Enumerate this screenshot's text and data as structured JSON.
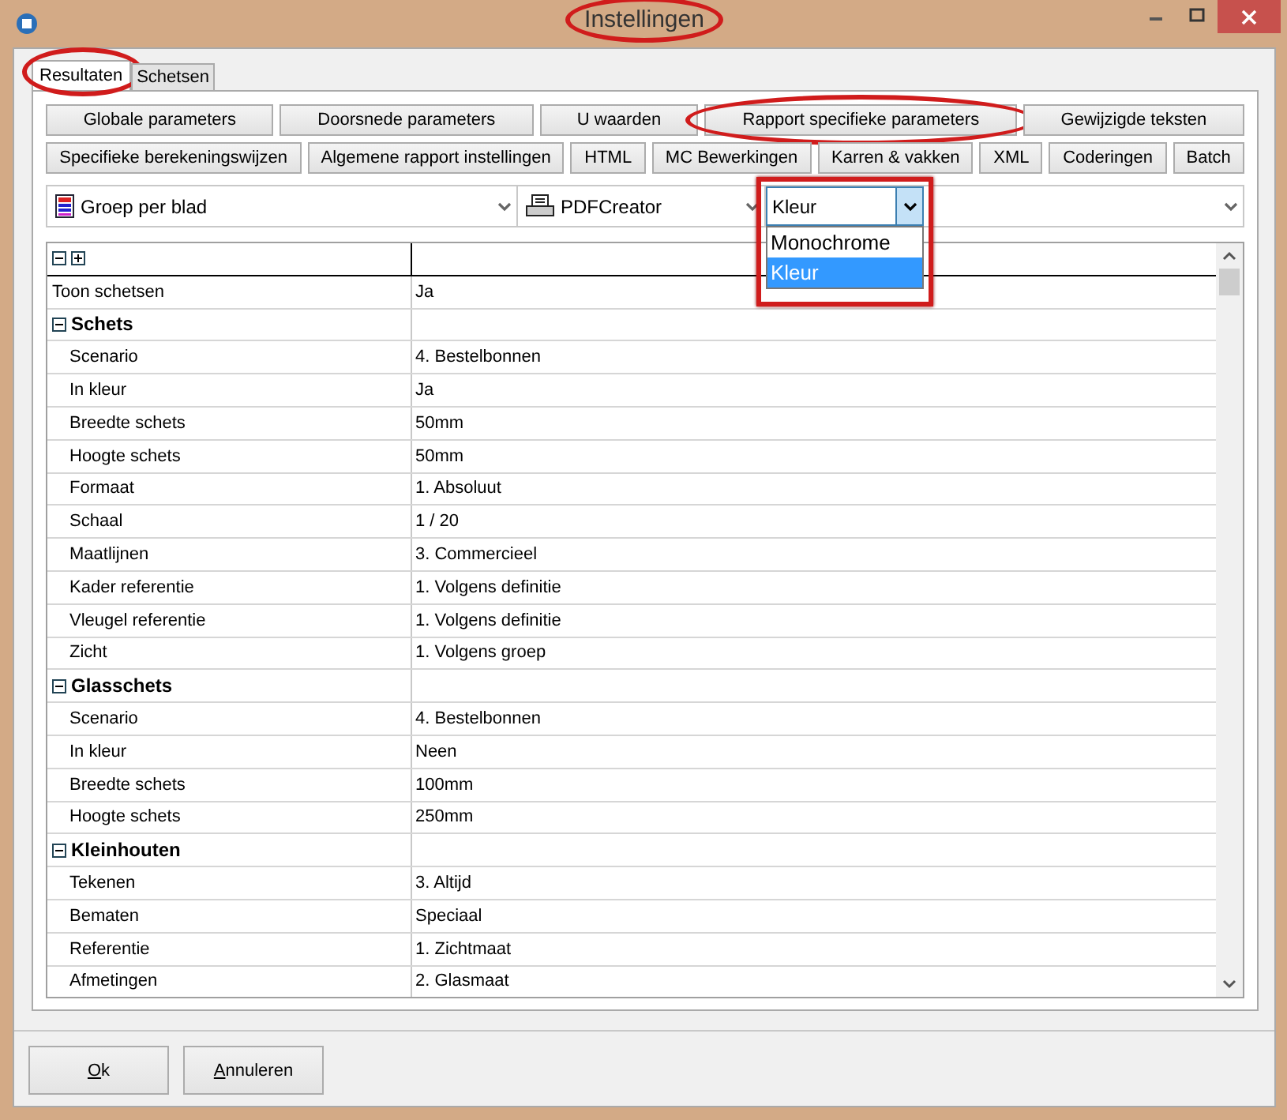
{
  "window": {
    "title": "Instellingen",
    "circled": true
  },
  "tabs": [
    {
      "label": "Resultaten",
      "selected": true,
      "circled": true
    },
    {
      "label": "Schetsen",
      "selected": false,
      "circled": false
    }
  ],
  "button_rows": [
    [
      {
        "label": "Globale parameters",
        "circled": false
      },
      {
        "label": "Doorsnede parameters",
        "circled": false
      },
      {
        "label": "U waarden",
        "circled": false
      },
      {
        "label": "Rapport specifieke parameters",
        "circled": true
      },
      {
        "label": "Gewijzigde teksten",
        "circled": false
      }
    ],
    [
      {
        "label": "Specifieke berekeningswijzen",
        "circled": false
      },
      {
        "label": "Algemene rapport instellingen",
        "circled": false
      },
      {
        "label": "HTML",
        "circled": false
      },
      {
        "label": "MC Bewerkingen",
        "circled": false
      },
      {
        "label": "Karren & vakken",
        "circled": false
      },
      {
        "label": "XML",
        "circled": false
      },
      {
        "label": "Coderingen",
        "circled": false
      },
      {
        "label": "Batch",
        "circled": false
      }
    ]
  ],
  "selectors": [
    {
      "kind": "layout",
      "value": "Groep per blad"
    },
    {
      "kind": "printer",
      "value": "PDFCreator"
    },
    {
      "kind": "color",
      "value": "Kleur",
      "expanded": true,
      "framed": true,
      "options": [
        {
          "label": "Monochrome",
          "selected": false
        },
        {
          "label": "Kleur",
          "selected": true
        }
      ]
    },
    {
      "kind": "empty"
    }
  ],
  "grid": {
    "rows": [
      {
        "kind": "property",
        "name": "Toon schetsen",
        "value": "Ja"
      },
      {
        "kind": "category",
        "name": "Schets",
        "expanded": true,
        "children": [
          {
            "kind": "property",
            "name": "Scenario",
            "value": "4. Bestelbonnen"
          },
          {
            "kind": "property",
            "name": "In kleur",
            "value": "Ja"
          },
          {
            "kind": "property",
            "name": "Breedte schets",
            "value": "50mm"
          },
          {
            "kind": "property",
            "name": "Hoogte schets",
            "value": "50mm"
          },
          {
            "kind": "property",
            "name": "Formaat",
            "value": "1. Absoluut"
          },
          {
            "kind": "property",
            "name": "Schaal",
            "value": "1 / 20"
          },
          {
            "kind": "property",
            "name": "Maatlijnen",
            "value": "3. Commercieel"
          },
          {
            "kind": "property",
            "name": "Kader referentie",
            "value": "1. Volgens definitie"
          },
          {
            "kind": "property",
            "name": "Vleugel referentie",
            "value": "1. Volgens definitie"
          },
          {
            "kind": "property",
            "name": "Zicht",
            "value": "1. Volgens groep"
          }
        ]
      },
      {
        "kind": "category",
        "name": "Glasschets",
        "expanded": true,
        "children": [
          {
            "kind": "property",
            "name": "Scenario",
            "value": "4. Bestelbonnen"
          },
          {
            "kind": "property",
            "name": "In kleur",
            "value": "Neen"
          },
          {
            "kind": "property",
            "name": "Breedte schets",
            "value": "100mm"
          },
          {
            "kind": "property",
            "name": "Hoogte schets",
            "value": "250mm"
          }
        ]
      },
      {
        "kind": "category",
        "name": "Kleinhouten",
        "expanded": true,
        "children": [
          {
            "kind": "property",
            "name": "Tekenen",
            "value": "3. Altijd"
          },
          {
            "kind": "property",
            "name": "Bematen",
            "value": "Speciaal"
          },
          {
            "kind": "property",
            "name": "Referentie",
            "value": "1. Zichtmaat"
          },
          {
            "kind": "property",
            "name": "Afmetingen",
            "value": "2. Glasmaat"
          }
        ]
      }
    ]
  },
  "footer_buttons": [
    {
      "label": "Ok",
      "accelerator": true
    },
    {
      "label": "Annuleren",
      "accelerator": true
    }
  ]
}
